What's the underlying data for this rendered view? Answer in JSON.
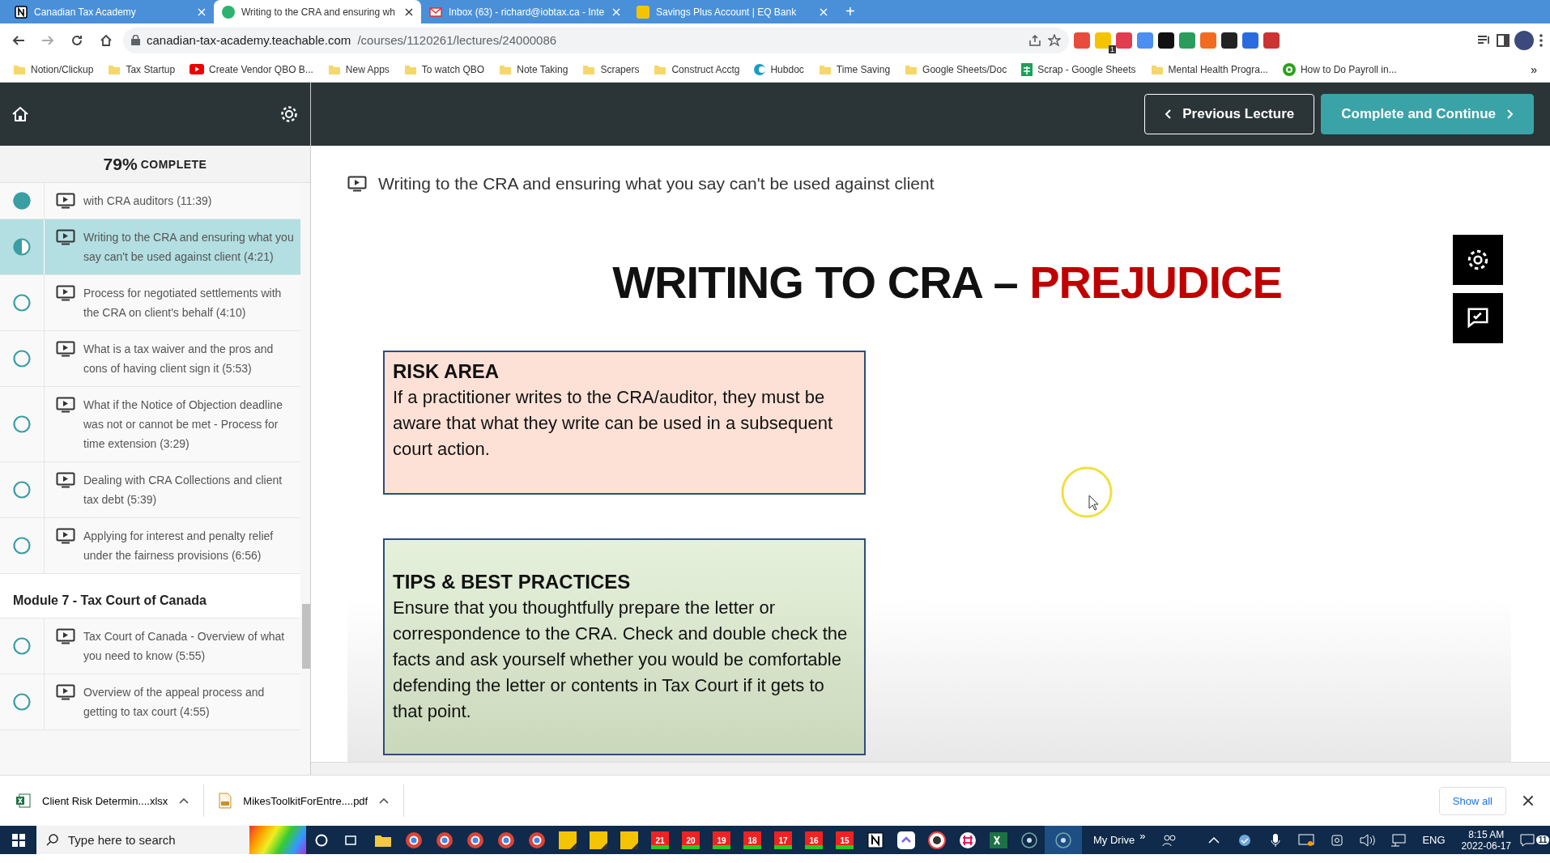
{
  "browser": {
    "tabs": [
      {
        "title": "Canadian Tax Academy",
        "selected": false
      },
      {
        "title": "Writing to the CRA and ensuring wh",
        "selected": true
      },
      {
        "title": "Inbox (63) - richard@iobtax.ca - Inte",
        "selected": false
      },
      {
        "title": "Savings Plus Account | EQ Bank",
        "selected": false
      }
    ],
    "new_tab": "+",
    "address": {
      "host": "canadian-tax-academy.teachable.com",
      "path": "/courses/1120261/lectures/24000086"
    },
    "extension_badge": "1",
    "bookmarks": [
      {
        "label": "Notion/Clickup",
        "kind": "folder"
      },
      {
        "label": "Tax Startup",
        "kind": "folder"
      },
      {
        "label": "Create Vendor QBO B...",
        "kind": "video"
      },
      {
        "label": "New Apps",
        "kind": "folder"
      },
      {
        "label": "To watch QBO",
        "kind": "folder"
      },
      {
        "label": "Note Taking",
        "kind": "folder"
      },
      {
        "label": "Scrapers",
        "kind": "folder"
      },
      {
        "label": "Construct Acctg",
        "kind": "folder"
      },
      {
        "label": "Hubdoc",
        "kind": "site"
      },
      {
        "label": "Time Saving",
        "kind": "folder"
      },
      {
        "label": "Google Sheets/Doc",
        "kind": "folder"
      },
      {
        "label": "Scrap - Google Sheets",
        "kind": "sheet"
      },
      {
        "label": "Mental Health Progra...",
        "kind": "folder"
      },
      {
        "label": "How to Do Payroll in...",
        "kind": "qb"
      }
    ],
    "bookmarks_more": "»"
  },
  "header": {
    "previous": "Previous Lecture",
    "next": "Complete and Continue"
  },
  "sidebar": {
    "percent": "79%",
    "complete_label": "COMPLETE",
    "items": [
      {
        "kind": "lesson",
        "text": "with CRA auditors (11:39)",
        "completed": true,
        "started": true,
        "selected": false
      },
      {
        "kind": "lesson",
        "text": "Writing to the CRA and ensuring what you say can't be used against client (4:21)",
        "completed": false,
        "started": true,
        "selected": true
      },
      {
        "kind": "lesson",
        "text": "Process for negotiated settlements with the CRA on client's behalf (4:10)",
        "completed": false,
        "started": false,
        "selected": false
      },
      {
        "kind": "lesson",
        "text": "What is a tax waiver and the pros and cons of having client sign it (5:53)",
        "completed": false,
        "started": false,
        "selected": false
      },
      {
        "kind": "lesson",
        "text": "What if the Notice of Objection deadline was not or cannot be met - Process for time extension (3:29)",
        "completed": false,
        "started": false,
        "selected": false
      },
      {
        "kind": "lesson",
        "text": "Dealing with CRA Collections and client tax debt (5:39)",
        "completed": false,
        "started": false,
        "selected": false
      },
      {
        "kind": "lesson",
        "text": "Applying for interest and penalty relief under the fairness provisions (6:56)",
        "completed": false,
        "started": false,
        "selected": false
      },
      {
        "kind": "module",
        "text": "Module 7 - Tax Court of Canada"
      },
      {
        "kind": "lesson",
        "text": "Tax Court of Canada - Overview of what you need to know (5:55)",
        "completed": false,
        "started": false,
        "selected": false
      },
      {
        "kind": "lesson",
        "text": "Overview of the appeal process and getting to tax court (4:55)",
        "completed": false,
        "started": false,
        "selected": false
      }
    ]
  },
  "lecture": {
    "title": "Writing to the CRA and ensuring what you say can't be used against client",
    "slide": {
      "title": "WRITING TO CRA –",
      "title_accent": "PREJUDICE",
      "boxes": [
        {
          "kind": "risk",
          "heading": "RISK AREA",
          "body": "If a practitioner writes to the CRA/auditor, they must be aware that what they write can be used in a subsequent court action."
        },
        {
          "kind": "tips",
          "heading": "TIPS & BEST PRACTICES",
          "body": "Ensure that you thoughtfully prepare the letter or correspondence to the CRA. Check and double check the facts and ask yourself whether you would be comfortable defending the letter or contents in Tax Court if it gets to that point."
        }
      ]
    }
  },
  "downloads": {
    "items": [
      {
        "name": "Client Risk Determin....xlsx",
        "kind": "xlsx"
      },
      {
        "name": "MikesToolkitForEntre....pdf",
        "kind": "pdf"
      }
    ],
    "show_all": "Show all"
  },
  "taskbar": {
    "search_placeholder": "Type here to search",
    "calendar_days": [
      "21",
      "20",
      "19",
      "18",
      "17",
      "16",
      "15"
    ],
    "drive_label": "My Drive",
    "drive_more": "»",
    "language": "ENG",
    "time": "8:15 AM",
    "date": "2022-06-17",
    "notifications": "11"
  }
}
